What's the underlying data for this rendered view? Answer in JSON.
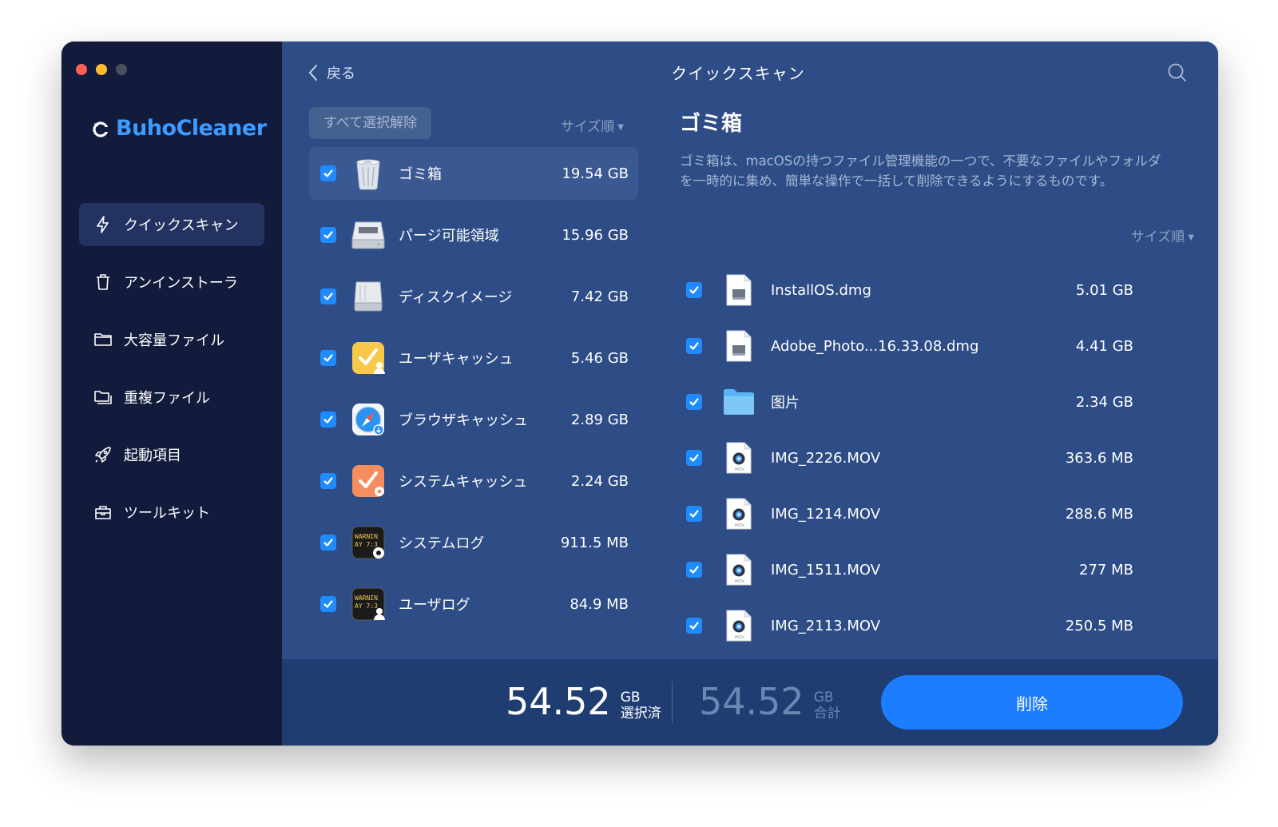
{
  "app": {
    "brand": "BuhoCleaner",
    "colors": {
      "accent": "#1c7dff",
      "sidebar": "#121b3c",
      "main": "#2e4c85",
      "close": "#fe5f57",
      "minimize": "#febc2e",
      "zoom": "#4a4f5f"
    }
  },
  "sidebar": {
    "items": [
      {
        "label": "クイックスキャン",
        "icon": "bolt-icon",
        "active": true
      },
      {
        "label": "アンインストーラ",
        "icon": "trash-icon"
      },
      {
        "label": "大容量ファイル",
        "icon": "folder-icon"
      },
      {
        "label": "重複ファイル",
        "icon": "duplicate-folder-icon"
      },
      {
        "label": "起動項目",
        "icon": "rocket-icon"
      },
      {
        "label": "ツールキット",
        "icon": "toolbox-icon"
      }
    ]
  },
  "header": {
    "back_label": "戻る",
    "title": "クイックスキャン"
  },
  "list": {
    "deselect_label": "すべて選択解除",
    "sort_label": "サイズ順",
    "categories": [
      {
        "name": "ゴミ箱",
        "size": "19.54 GB",
        "icon": "trash-bin-icon",
        "checked": true,
        "selected": true
      },
      {
        "name": "パージ可能領域",
        "size": "15.96 GB",
        "icon": "hard-drive-icon",
        "checked": true
      },
      {
        "name": "ディスクイメージ",
        "size": "7.42 GB",
        "icon": "disk-image-icon",
        "checked": true
      },
      {
        "name": "ユーザキャッシュ",
        "size": "5.46 GB",
        "icon": "user-cache-icon",
        "checked": true
      },
      {
        "name": "ブラウザキャッシュ",
        "size": "2.89 GB",
        "icon": "browser-cache-icon",
        "checked": true
      },
      {
        "name": "システムキャッシュ",
        "size": "2.24 GB",
        "icon": "system-cache-icon",
        "checked": true
      },
      {
        "name": "システムログ",
        "size": "911.5 MB",
        "icon": "system-log-icon",
        "checked": true
      },
      {
        "name": "ユーザログ",
        "size": "84.9 MB",
        "icon": "user-log-icon",
        "checked": true
      }
    ]
  },
  "detail": {
    "title": "ゴミ箱",
    "description": "ゴミ箱は、macOSの持つファイル管理機能の一つで、不要なファイルやフォルダを一時的に集め、簡単な操作で一括して削除できるようにするものです。",
    "sort_label": "サイズ順",
    "files": [
      {
        "name": "InstallOS.dmg",
        "size": "5.01 GB",
        "icon": "dmg-file-icon",
        "checked": true
      },
      {
        "name": "Adobe_Photo...16.33.08.dmg",
        "size": "4.41 GB",
        "icon": "dmg-file-icon",
        "checked": true
      },
      {
        "name": "图片",
        "size": "2.34 GB",
        "icon": "folder-icon",
        "checked": true
      },
      {
        "name": "IMG_2226.MOV",
        "size": "363.6 MB",
        "icon": "mov-file-icon",
        "checked": true
      },
      {
        "name": "IMG_1214.MOV",
        "size": "288.6 MB",
        "icon": "mov-file-icon",
        "checked": true
      },
      {
        "name": "IMG_1511.MOV",
        "size": "277 MB",
        "icon": "mov-file-icon",
        "checked": true
      },
      {
        "name": "IMG_2113.MOV",
        "size": "250.5 MB",
        "icon": "mov-file-icon",
        "checked": true
      }
    ]
  },
  "footer": {
    "selected_value": "54.52",
    "selected_unit": "GB",
    "selected_label": "選択済",
    "total_value": "54.52",
    "total_unit": "GB",
    "total_label": "合計",
    "delete_label": "削除"
  }
}
